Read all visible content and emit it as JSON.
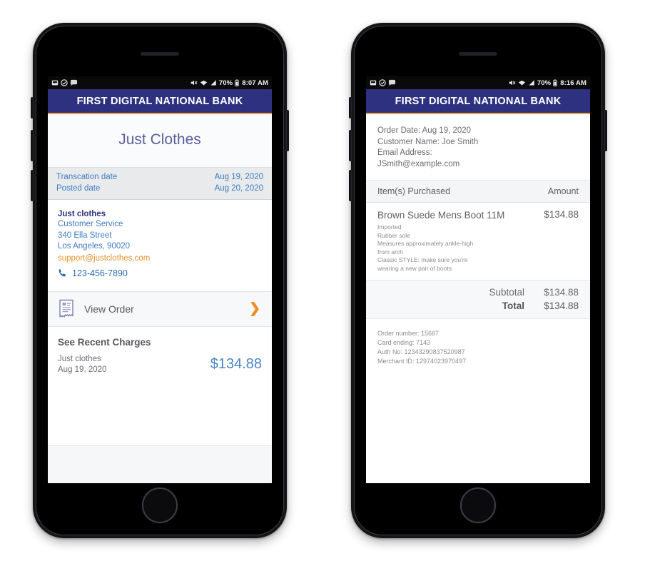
{
  "phone1": {
    "status_bar": {
      "icons_left": [
        "sd-card-icon",
        "alarm-icon",
        "message-icon"
      ],
      "icons_right": [
        "mute-icon",
        "wifi-icon",
        "signal-icon"
      ],
      "battery": "70%",
      "time": "8:07 AM"
    },
    "header": {
      "title": "FIRST DIGITAL NATIONAL BANK"
    },
    "merchant_title": "Just Clothes",
    "dates": [
      {
        "label": "Transcation date",
        "value": "Aug 19, 2020"
      },
      {
        "label": "Posted date",
        "value": "Aug 20, 2020"
      }
    ],
    "merchant": {
      "name": "Just clothes",
      "dept": "Customer Service",
      "street": "340 Ella Street",
      "city": "Los Angeles, 90020",
      "email": "support@justclothes.com",
      "phone": "123-456-7890"
    },
    "view_order": {
      "label": "View Order",
      "chevron": "❯"
    },
    "recent": {
      "title": "See Recent Charges",
      "merchant": "Just clothes",
      "date": "Aug 19, 2020",
      "amount": "$134.88"
    }
  },
  "phone2": {
    "status_bar": {
      "icons_left": [
        "sd-card-icon",
        "alarm-icon",
        "message-icon"
      ],
      "icons_right": [
        "mute-icon",
        "wifi-icon",
        "signal-icon"
      ],
      "battery": "70%",
      "time": "8:16 AM"
    },
    "header": {
      "title": "FIRST DIGITAL NATIONAL BANK"
    },
    "order_meta": {
      "order_date": "Order Date: Aug 19, 2020",
      "customer_name": "Customer Name: Joe Smith",
      "email_label": "Email Address:",
      "email_value": "JSmith@example.com"
    },
    "items_header": {
      "items": "Item(s) Purchased",
      "amount": "Amount"
    },
    "item": {
      "name": "Brown Suede Mens Boot 11M",
      "price": "$134.88",
      "desc_lines": [
        "Imported",
        "Rubber sole",
        "Measures approximately ankle-high",
        "from arch",
        "Classic STYLE: make sure you're",
        "wearing a new pair of boots"
      ]
    },
    "totals": [
      {
        "label": "Subtotal",
        "value": "$134.88"
      },
      {
        "label": "Total",
        "value": "$134.88"
      }
    ],
    "order_ids": [
      "Order number: 15667",
      "Card ending: 7143",
      "Auth No: 12343290837520987",
      "Merchant ID: 12974023970497"
    ]
  },
  "colors": {
    "bank_navy": "#2e3180",
    "accent_orange": "#e8a33d",
    "link_blue": "#3f7cc0",
    "email_orange": "#e88f2a",
    "amount_blue": "#4a86c8",
    "title_indigo": "#5b5f99"
  }
}
